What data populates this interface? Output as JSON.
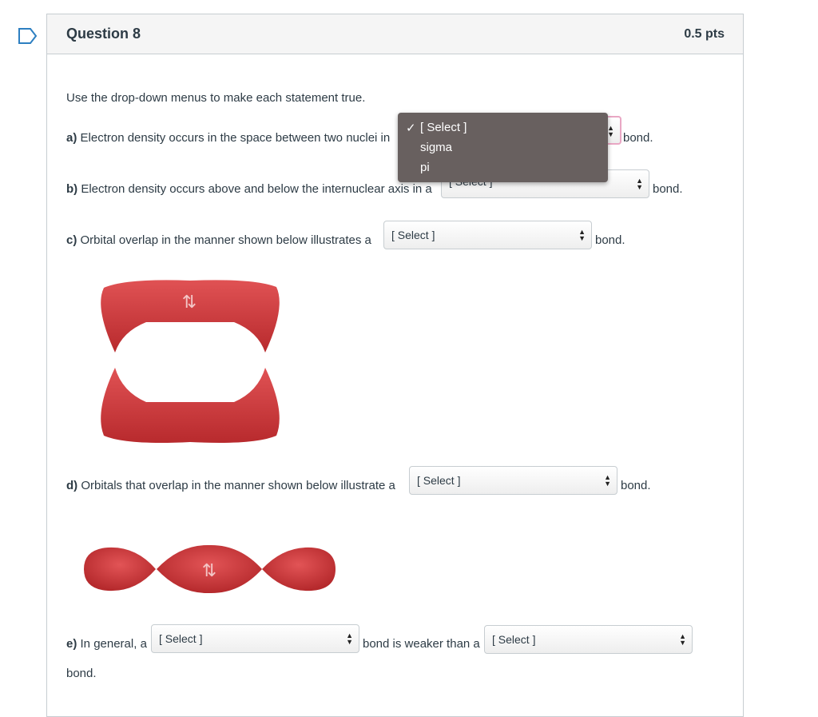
{
  "question": {
    "title": "Question 8",
    "points": "0.5 pts"
  },
  "instructions": "Use the drop-down menus to make each statement true.",
  "statements": {
    "a": {
      "letter": "a)",
      "text": "Electron density occurs in the space between two nuclei in",
      "suffix": "bond.",
      "select": "[ Select ]"
    },
    "b": {
      "letter": "b)",
      "text": "Electron density occurs above and below the internuclear axis in a",
      "suffix": "bond.",
      "select": "[ Select ]"
    },
    "c": {
      "letter": "c)",
      "text": "Orbital overlap in the manner shown below illustrates a",
      "suffix": "bond.",
      "select": "[ Select ]"
    },
    "d": {
      "letter": "d)",
      "text": "Orbitals that overlap in the manner shown below illustrate a",
      "suffix": "bond.",
      "select": "[ Select ]"
    },
    "e": {
      "letter": "e)",
      "text": "In general, a",
      "middle": "bond is weaker than a",
      "select1": "[ Select ]",
      "select2": "[ Select ]",
      "end": "bond."
    }
  },
  "dropdown_open": {
    "options": [
      "[ Select ]",
      "sigma",
      "pi"
    ],
    "selected": "[ Select ]",
    "check": "✓"
  },
  "orbital_labels": {
    "pi_electrons": "⇅",
    "sigma_electrons": "⇅"
  },
  "colors": {
    "orbital_red": "#d0393b",
    "focus_ring": "#e9a7c4",
    "dropdown_bg": "#68605f"
  }
}
